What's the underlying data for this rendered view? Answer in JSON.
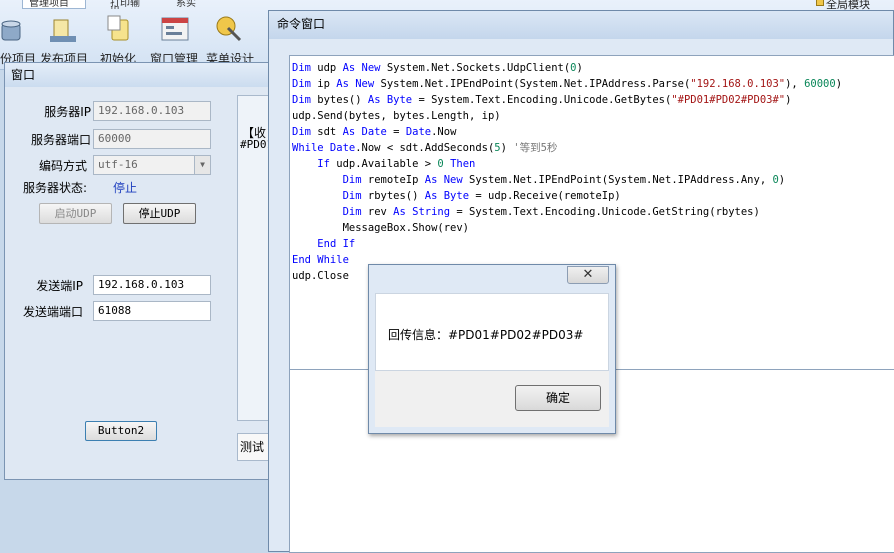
{
  "ribbon": {
    "tabs": [
      "管理项目",
      "打印输出",
      "系实"
    ],
    "labels": [
      "份项目",
      "发布项目",
      "初始化",
      "窗口管理",
      "菜单设计"
    ],
    "right_label": "全局模块"
  },
  "form_window": {
    "title": "窗口",
    "server_ip_label": "服务器IP",
    "server_ip_value": "192.168.0.103",
    "server_port_label": "服务器端口",
    "server_port_value": "60000",
    "encoding_label": "编码方式",
    "encoding_value": "utf-16",
    "status_label": "服务器状态:",
    "status_value": "停止",
    "start_udp_label": "启动UDP",
    "stop_udp_label": "停止UDP",
    "sender_ip_label": "发送端IP",
    "sender_ip_value": "192.168.0.103",
    "sender_port_label": "发送端端口",
    "sender_port_value": "61088",
    "button2_label": "Button2",
    "partial_text_1": "【收",
    "partial_text_2": "#PD01",
    "partial_text_3": "测试"
  },
  "command_window": {
    "title": "命令窗口",
    "code_lines": [
      "Dim udp As New System.Net.Sockets.UdpClient(0)",
      "Dim ip As New System.Net.IPEndPoint(System.Net.IPAddress.Parse(\"192.168.0.103\"), 60000)",
      "Dim bytes() As Byte = System.Text.Encoding.Unicode.GetBytes(\"#PD01#PD02#PD03#\")",
      "udp.Send(bytes, bytes.Length, ip)",
      "Dim sdt As Date = Date.Now",
      "While Date.Now < sdt.AddSeconds(5) '等到5秒",
      "    If udp.Available > 0 Then",
      "        Dim remoteIp As New System.Net.IPEndPoint(System.Net.IPAddress.Any, 0)",
      "        Dim rbytes() As Byte = udp.Receive(remoteIp)",
      "        Dim rev As String = System.Text.Encoding.Unicode.GetString(rbytes)",
      "        MessageBox.Show(rev)",
      "    End If",
      "End While",
      "udp.Close"
    ]
  },
  "message_box": {
    "close_glyph": "✕",
    "message": "回传信息：#PD01#PD02#PD03#",
    "ok_label": "确定"
  }
}
